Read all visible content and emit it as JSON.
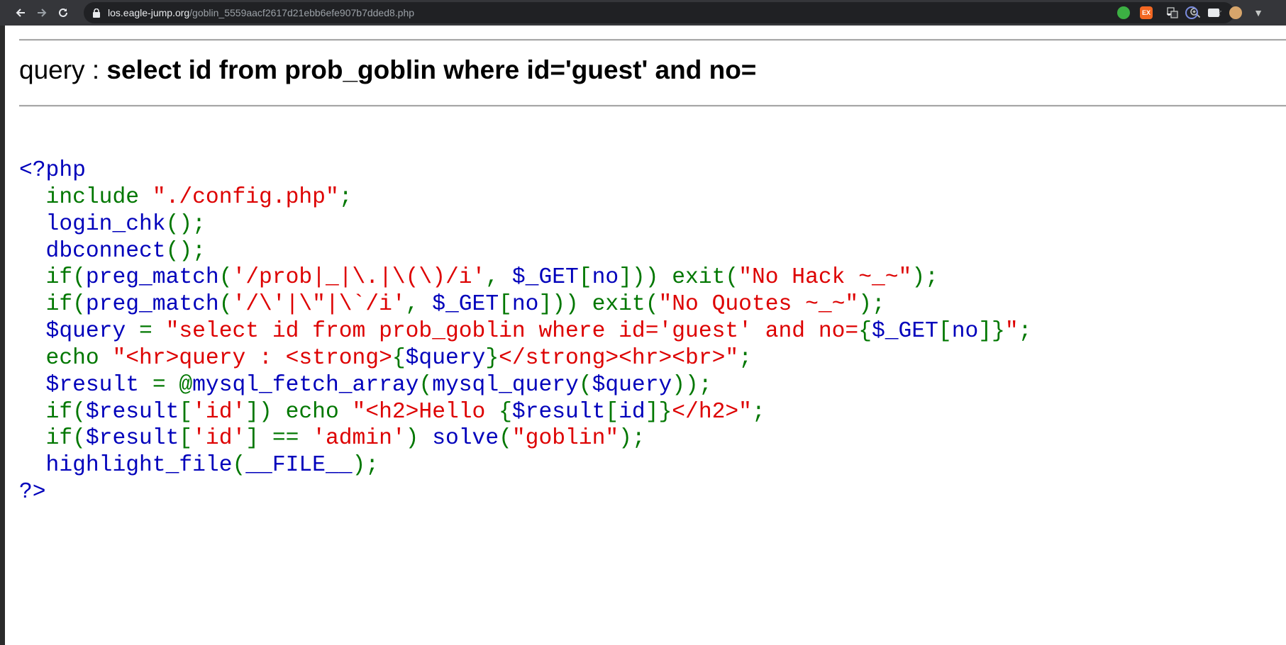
{
  "browser": {
    "url_host": "los.eagle-jump.org",
    "url_path": "/goblin_5559aacf2617d21ebb6efe907b7dded8.php",
    "icons": [
      "back-icon",
      "forward-icon",
      "reload-icon",
      "lock-icon",
      "translate-icon",
      "zoom-icon",
      "star-icon",
      "evernote-icon",
      "ex-extension-icon",
      "ghostery-icon",
      "circle-extension-icon",
      "card-extension-icon",
      "cookie-extension-icon",
      "vee-extension-icon"
    ],
    "ex_badge": "EX"
  },
  "page": {
    "query_label": "query : ",
    "query_text": "select id from prob_goblin where id='guest' and no="
  },
  "source_code": {
    "colors": {
      "default": "#0000BB",
      "keyword": "#007700",
      "string": "#DD0000"
    },
    "lines": [
      [
        [
          "d",
          "<?php"
        ]
      ],
      [
        [
          "k",
          "  include "
        ],
        [
          "s",
          "\"./config.php\""
        ],
        [
          "k",
          ";"
        ]
      ],
      [
        [
          "d",
          "  login_chk"
        ],
        [
          "k",
          "();"
        ]
      ],
      [
        [
          "d",
          "  dbconnect"
        ],
        [
          "k",
          "();"
        ]
      ],
      [
        [
          "d",
          "  "
        ],
        [
          "k",
          "if("
        ],
        [
          "d",
          "preg_match"
        ],
        [
          "k",
          "("
        ],
        [
          "s",
          "'/prob|_|\\.|\\(\\)/i'"
        ],
        [
          "k",
          ", "
        ],
        [
          "d",
          "$_GET"
        ],
        [
          "k",
          "["
        ],
        [
          "d",
          "no"
        ],
        [
          "k",
          "])) exit("
        ],
        [
          "s",
          "\"No Hack ~_~\""
        ],
        [
          "k",
          ");"
        ]
      ],
      [
        [
          "d",
          "  "
        ],
        [
          "k",
          "if("
        ],
        [
          "d",
          "preg_match"
        ],
        [
          "k",
          "("
        ],
        [
          "s",
          "'/\\'|\\\"|\\`/i'"
        ],
        [
          "k",
          ", "
        ],
        [
          "d",
          "$_GET"
        ],
        [
          "k",
          "["
        ],
        [
          "d",
          "no"
        ],
        [
          "k",
          "])) exit("
        ],
        [
          "s",
          "\"No Quotes ~_~\""
        ],
        [
          "k",
          ");"
        ]
      ],
      [
        [
          "d",
          "  $query "
        ],
        [
          "k",
          "= "
        ],
        [
          "s",
          "\"select id from prob_goblin where id='guest' and no="
        ],
        [
          "k",
          "{"
        ],
        [
          "d",
          "$_GET"
        ],
        [
          "k",
          "["
        ],
        [
          "d",
          "no"
        ],
        [
          "k",
          "]}"
        ],
        [
          "s",
          "\""
        ],
        [
          "k",
          ";"
        ]
      ],
      [
        [
          "k",
          "  echo "
        ],
        [
          "s",
          "\"<hr>query : <strong>"
        ],
        [
          "k",
          "{"
        ],
        [
          "d",
          "$query"
        ],
        [
          "k",
          "}"
        ],
        [
          "s",
          "</strong><hr><br>\""
        ],
        [
          "k",
          ";"
        ]
      ],
      [
        [
          "d",
          "  $result "
        ],
        [
          "k",
          "= @"
        ],
        [
          "d",
          "mysql_fetch_array"
        ],
        [
          "k",
          "("
        ],
        [
          "d",
          "mysql_query"
        ],
        [
          "k",
          "("
        ],
        [
          "d",
          "$query"
        ],
        [
          "k",
          "));"
        ]
      ],
      [
        [
          "d",
          "  "
        ],
        [
          "k",
          "if("
        ],
        [
          "d",
          "$result"
        ],
        [
          "k",
          "["
        ],
        [
          "s",
          "'id'"
        ],
        [
          "k",
          "]) echo "
        ],
        [
          "s",
          "\"<h2>Hello "
        ],
        [
          "k",
          "{"
        ],
        [
          "d",
          "$result"
        ],
        [
          "k",
          "["
        ],
        [
          "d",
          "id"
        ],
        [
          "k",
          "]}"
        ],
        [
          "s",
          "</h2>\""
        ],
        [
          "k",
          ";"
        ]
      ],
      [
        [
          "d",
          "  "
        ],
        [
          "k",
          "if("
        ],
        [
          "d",
          "$result"
        ],
        [
          "k",
          "["
        ],
        [
          "s",
          "'id'"
        ],
        [
          "k",
          "] == "
        ],
        [
          "s",
          "'admin'"
        ],
        [
          "k",
          ") "
        ],
        [
          "d",
          "solve"
        ],
        [
          "k",
          "("
        ],
        [
          "s",
          "\"goblin\""
        ],
        [
          "k",
          ");"
        ]
      ],
      [
        [
          "d",
          "  highlight_file"
        ],
        [
          "k",
          "("
        ],
        [
          "d",
          "__FILE__"
        ],
        [
          "k",
          ");"
        ]
      ],
      [
        [
          "d",
          "?>"
        ]
      ]
    ]
  }
}
